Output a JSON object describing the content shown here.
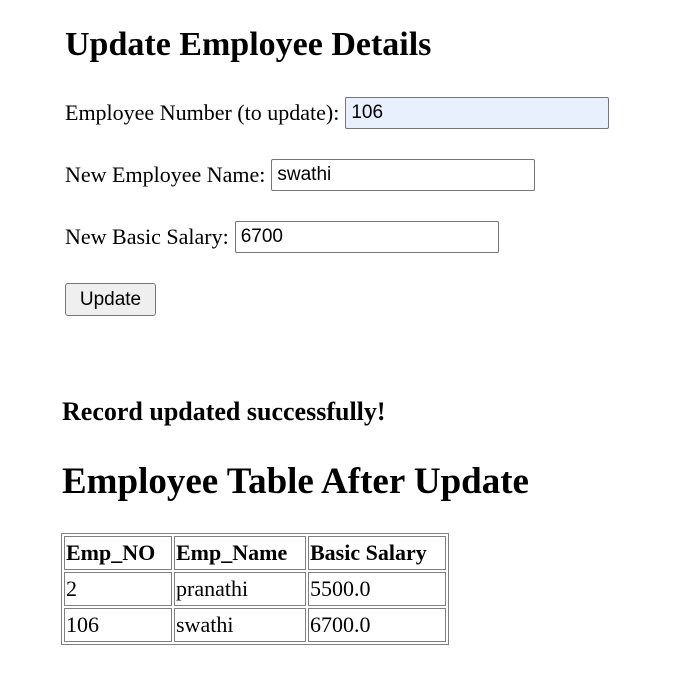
{
  "form": {
    "heading": "Update Employee Details",
    "emp_no_label": "Employee Number (to update):",
    "emp_no_value": "106",
    "name_label": "New Employee Name:",
    "name_value": "swathi",
    "salary_label": "New Basic Salary:",
    "salary_value": "6700",
    "submit_label": "Update",
    "emp_no_autofill_color": "#e8f0fe"
  },
  "result": {
    "message": "Record updated successfully!",
    "table_heading": "Employee Table After Update",
    "columns": [
      "Emp_NO",
      "Emp_Name",
      "Basic Salary"
    ],
    "rows": [
      [
        "2",
        "pranathi",
        "5500.0"
      ],
      [
        "106",
        "swathi",
        "6700.0"
      ]
    ]
  }
}
